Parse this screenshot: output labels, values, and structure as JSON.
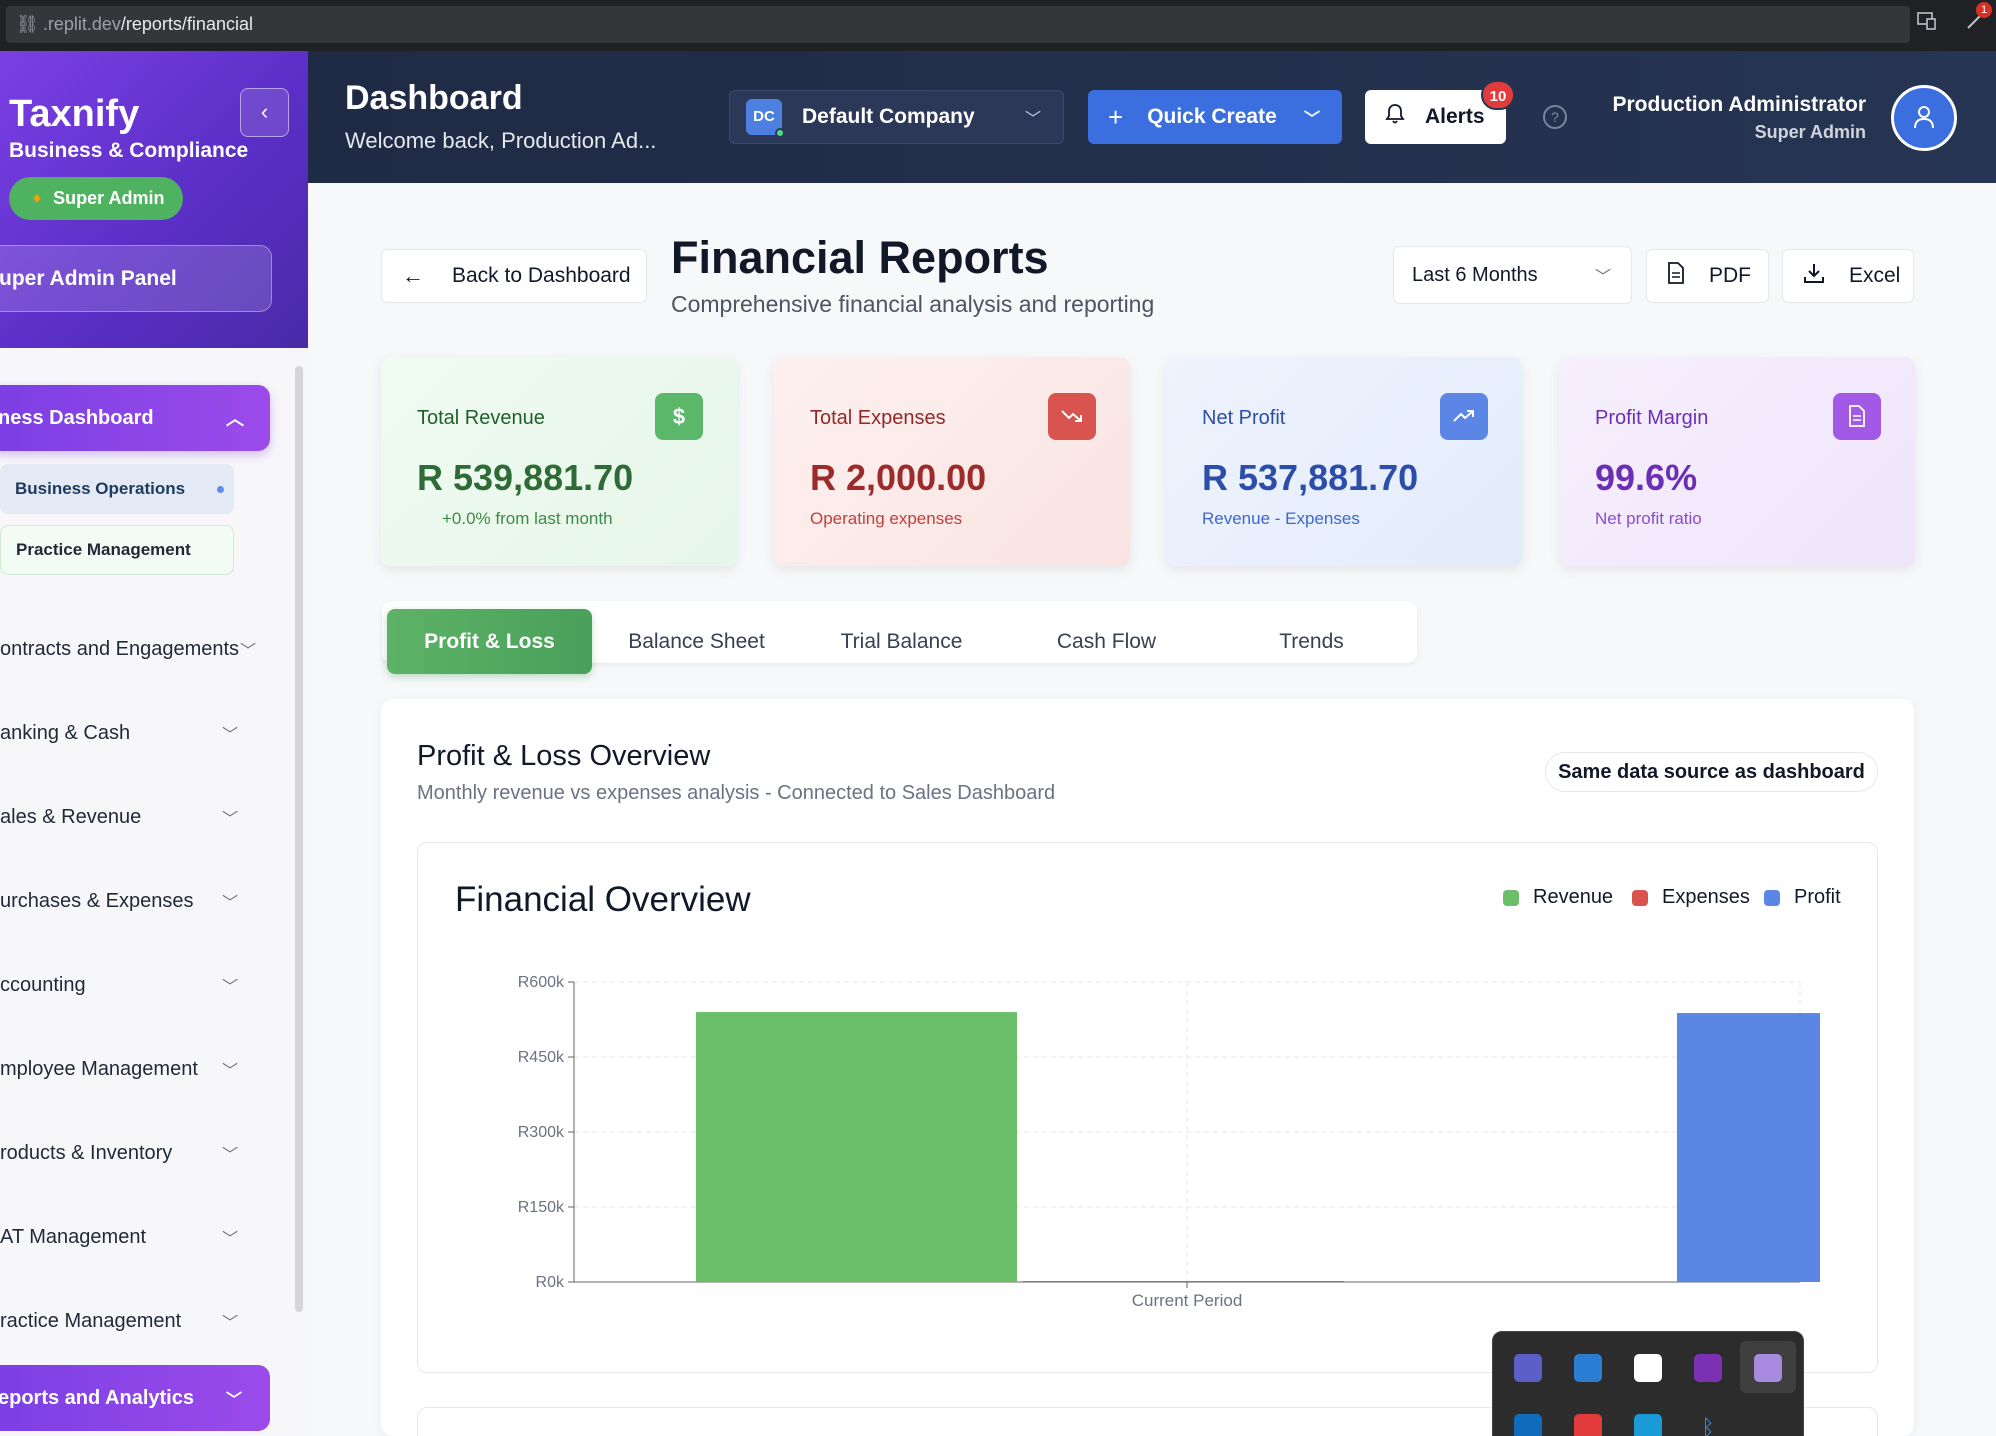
{
  "browser": {
    "url_dim": ".replit.dev",
    "url_bright": "/reports/financial",
    "ext_badge": "1"
  },
  "sidebar": {
    "brand": "Taxnify",
    "brand_sub": "Business & Compliance",
    "role_pill": "Super Admin",
    "panel_button": "uper Admin Panel",
    "active_section": "ness Dashboard",
    "sub_items": [
      {
        "label": "Business Operations"
      },
      {
        "label": "Practice Management"
      }
    ],
    "items": [
      {
        "label": "ontracts and Engagements"
      },
      {
        "label": "anking & Cash"
      },
      {
        "label": "ales & Revenue"
      },
      {
        "label": "urchases & Expenses"
      },
      {
        "label": "ccounting"
      },
      {
        "label": "mployee Management"
      },
      {
        "label": "roducts & Inventory"
      },
      {
        "label": "AT Management"
      },
      {
        "label": "ractice Management"
      }
    ],
    "bottom_section": "eports and Analytics"
  },
  "header": {
    "title": "Dashboard",
    "subtitle": "Welcome back, Production Ad...",
    "company_badge": "DC",
    "company_name": "Default Company",
    "quick_create": "Quick Create",
    "alerts": "Alerts",
    "alerts_count": "10",
    "user_name": "Production Administrator",
    "user_role": "Super Admin"
  },
  "page": {
    "back_label": "Back to Dashboard",
    "title": "Financial Reports",
    "subtitle": "Comprehensive financial analysis and reporting",
    "range": "Last 6 Months",
    "pdf": "PDF",
    "excel": "Excel"
  },
  "stats": [
    {
      "label": "Total Revenue",
      "value": "R 539,881.70",
      "note": "+0.0% from last month",
      "icon": "dollar-icon",
      "color": "#2e7d3a"
    },
    {
      "label": "Total Expenses",
      "value": "R 2,000.00",
      "note": "Operating expenses",
      "icon": "trending-down-icon",
      "color": "#a12b2b"
    },
    {
      "label": "Net Profit",
      "value": "R 537,881.70",
      "note": "Revenue - Expenses",
      "icon": "trending-up-icon",
      "color": "#2c4ea8"
    },
    {
      "label": "Profit Margin",
      "value": "99.6%",
      "note": "Net profit ratio",
      "icon": "document-icon",
      "color": "#6b2fb3"
    }
  ],
  "tabs": [
    {
      "label": "Profit & Loss"
    },
    {
      "label": "Balance Sheet"
    },
    {
      "label": "Trial Balance"
    },
    {
      "label": "Cash Flow"
    },
    {
      "label": "Trends"
    }
  ],
  "overview": {
    "title": "Profit & Loss Overview",
    "subtitle": "Monthly revenue vs expenses analysis - Connected to Sales Dashboard",
    "source_badge": "Same data source as dashboard"
  },
  "chart_data": {
    "type": "bar",
    "title": "Financial Overview",
    "categories": [
      "Current Period"
    ],
    "series": [
      {
        "name": "Revenue",
        "values": [
          539881.7
        ],
        "color": "#6bbf6b"
      },
      {
        "name": "Expenses",
        "values": [
          2000.0
        ],
        "color": "#d9534f"
      },
      {
        "name": "Profit",
        "values": [
          537881.7
        ],
        "color": "#5b86e5"
      }
    ],
    "ylim": [
      0,
      600000
    ],
    "yticks": [
      "R0k",
      "R150k",
      "R300k",
      "R450k",
      "R600k"
    ],
    "ytick_values": [
      0,
      150000,
      300000,
      450000,
      600000
    ],
    "grid": true,
    "legend": "top-right"
  }
}
